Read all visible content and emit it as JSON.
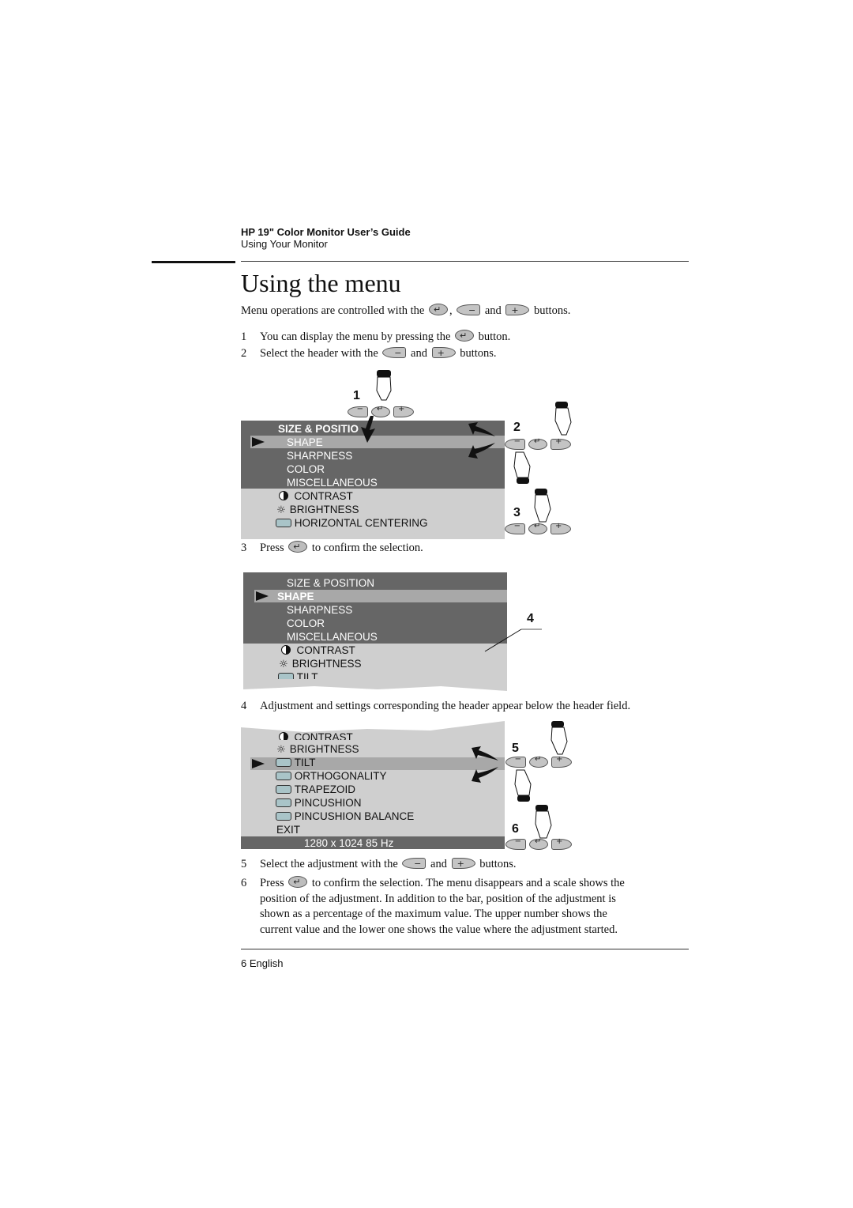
{
  "header": {
    "doc_title": "HP 19\" Color Monitor User’s Guide",
    "section": "Using Your Monitor"
  },
  "page_title": "Using the menu",
  "intro": {
    "before": "Menu operations are controlled with the",
    "sep1": ",",
    "and": "and",
    "after": "buttons."
  },
  "steps": [
    {
      "num": "1",
      "before": "You can display the menu by pressing the",
      "after": "button."
    },
    {
      "num": "2",
      "before": "Select the header with the",
      "and": "and",
      "after": "buttons."
    },
    {
      "num": "3",
      "before": "Press",
      "after": "to confirm the selection."
    },
    {
      "num": "4",
      "text": "Adjustment and settings corresponding the header appear below the header field."
    },
    {
      "num": "5",
      "before": "Select the adjustment with the",
      "and": "and",
      "after": "buttons."
    },
    {
      "num": "6",
      "before": "Press",
      "after": "to confirm the selection. The menu disappears and a scale shows the",
      "lines": [
        "position of the adjustment. In addition to the bar, position of the adjustment is",
        "shown as a percentage of the maximum value. The upper number shows the",
        "current value and the lower one shows the value where the adjustment started."
      ]
    }
  ],
  "buttons": {
    "enter": "enter-button",
    "minus": "minus-button",
    "plus": "plus-button",
    "minus_label": "−",
    "plus_label": "+",
    "enter_label": "↵"
  },
  "figure1": {
    "header": "SIZE & POSITION",
    "header_clipped": "SIZE & POSITIO",
    "menu_items": [
      "SHAPE",
      "SHARPNESS",
      "COLOR",
      "MISCELLANEOUS"
    ],
    "adjustments": [
      "CONTRAST",
      "BRIGHTNESS",
      "HORIZONTAL CENTERING"
    ],
    "selected": "SHAPE",
    "callouts": [
      "1",
      "2",
      "3"
    ]
  },
  "figure2": {
    "header": "SIZE & POSITION",
    "menu_items": [
      "SHAPE",
      "SHARPNESS",
      "COLOR",
      "MISCELLANEOUS"
    ],
    "adjustments": [
      "CONTRAST",
      "BRIGHTNESS",
      "TILT"
    ],
    "selected": "SHAPE",
    "callouts": [
      "4"
    ]
  },
  "figure3": {
    "adjustments": [
      "CONTRAST",
      "BRIGHTNESS",
      "TILT",
      "ORTHOGONALITY",
      "TRAPEZOID",
      "PINCUSHION",
      "PINCUSHION BALANCE"
    ],
    "exit": "EXIT",
    "status": "1280 x 1024  85 Hz",
    "selected": "TILT",
    "callouts": [
      "5",
      "6"
    ]
  },
  "footer": {
    "page": "6 English"
  }
}
